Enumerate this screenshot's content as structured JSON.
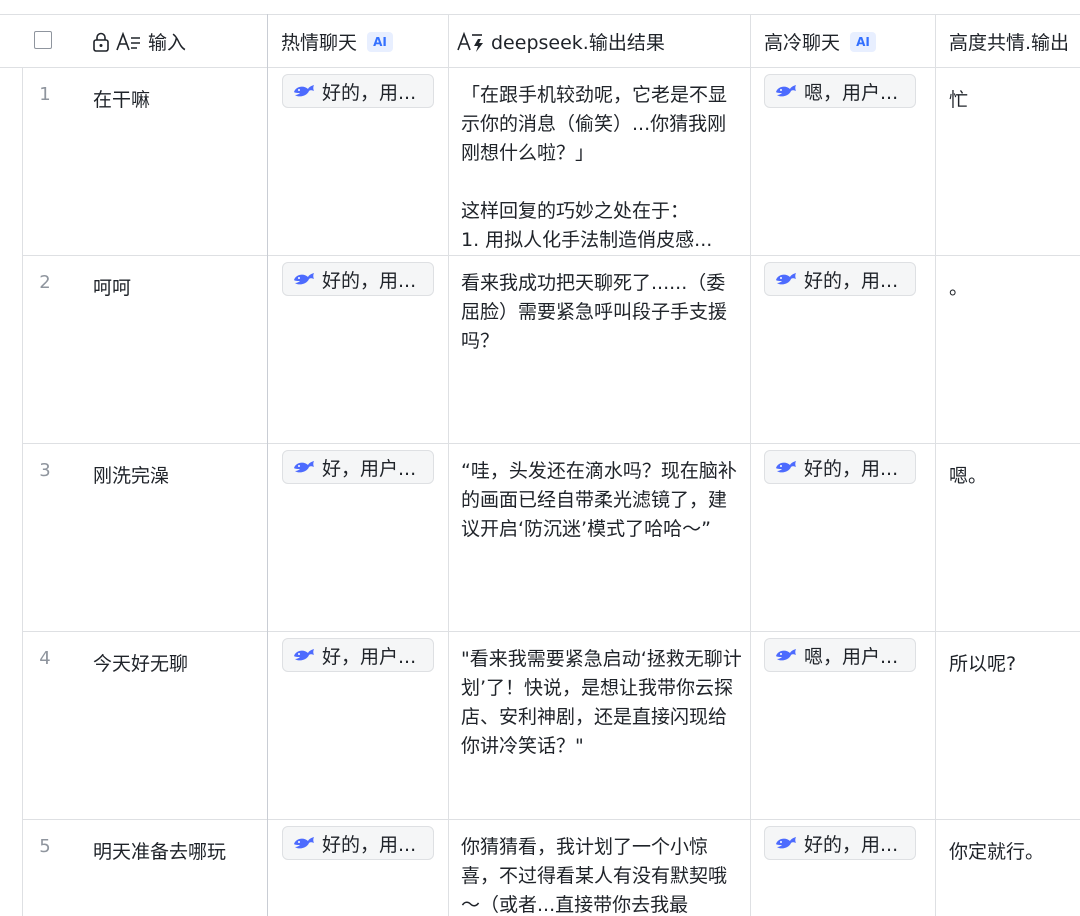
{
  "header": {
    "col_input": "输入",
    "col_warm": "热情聊天",
    "col_warm_badge": "AI",
    "col_deepseek": "deepseek.输出结果",
    "col_cold": "高冷聊天",
    "col_cold_badge": "AI",
    "col_empathy": "高度共情.输出"
  },
  "rows": [
    {
      "num": "1",
      "input": "在干嘛",
      "warm": "好的，用...",
      "deepseek": "「在跟手机较劲呢，它老是不显示你的消息（偷笑）...你猜我刚刚想什么啦？」\n\n这样回复的巧妙之处在于：\n1. 用拟人化手法制造俏皮感...",
      "cold": "嗯，用户...",
      "empathy": "忙"
    },
    {
      "num": "2",
      "input": "呵呵",
      "warm": "好的，用...",
      "deepseek": "看来我成功把天聊死了......（委屈脸）需要紧急呼叫段子手支援吗？",
      "cold": "好的，用...",
      "empathy": "。"
    },
    {
      "num": "3",
      "input": "刚洗完澡",
      "warm": "好，用户...",
      "deepseek": "“哇，头发还在滴水吗？现在脑补的画面已经自带柔光滤镜了，建议开启‘防沉迷’模式了哈哈～”",
      "cold": "好的，用...",
      "empathy": "嗯。"
    },
    {
      "num": "4",
      "input": "今天好无聊",
      "warm": "好，用户...",
      "deepseek": "\"看来我需要紧急启动‘拯救无聊计划’了！快说，是想让我带你云探店、安利神剧，还是直接闪现给你讲冷笑话？\"",
      "cold": "嗯，用户...",
      "empathy": "所以呢?"
    },
    {
      "num": "5",
      "input": "明天准备去哪玩",
      "warm": "好的，用...",
      "deepseek": "你猜猜看，我计划了一个小惊喜，不过得看某人有没有默契哦～（或者...直接带你去我最",
      "cold": "好的，用...",
      "empathy": "你定就行。"
    }
  ]
}
